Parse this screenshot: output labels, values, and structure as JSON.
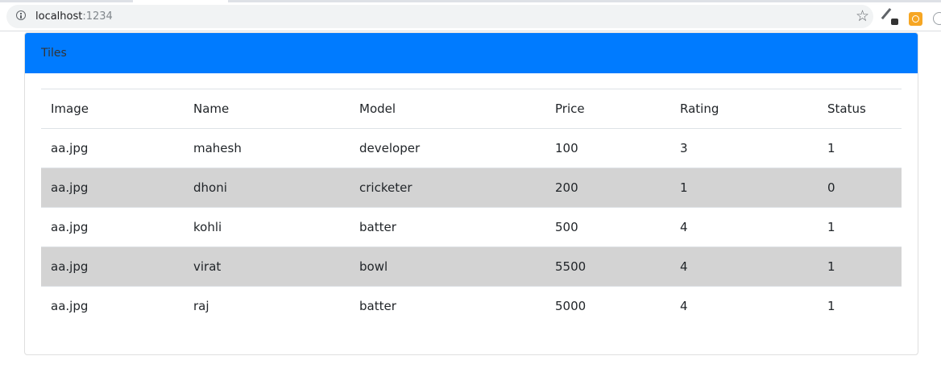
{
  "browser": {
    "url_host": "localhost",
    "url_port": ":1234",
    "icons": [
      "info-icon",
      "star-icon",
      "extension-pen-icon",
      "extension-box-icon",
      "extension-icon"
    ]
  },
  "card": {
    "title": "Tiles",
    "header_color": "#007bff",
    "alt_row_color": "#d3d3d3"
  },
  "table": {
    "headers": [
      "Image",
      "Name",
      "Model",
      "Price",
      "Rating",
      "Status"
    ],
    "rows": [
      [
        "aa.jpg",
        "mahesh",
        "developer",
        "100",
        "3",
        "1"
      ],
      [
        "aa.jpg",
        "dhoni",
        "cricketer",
        "200",
        "1",
        "0"
      ],
      [
        "aa.jpg",
        "kohli",
        "batter",
        "500",
        "4",
        "1"
      ],
      [
        "aa.jpg",
        "virat",
        "bowl",
        "5500",
        "4",
        "1"
      ],
      [
        "aa.jpg",
        "raj",
        "batter",
        "5000",
        "4",
        "1"
      ]
    ]
  }
}
